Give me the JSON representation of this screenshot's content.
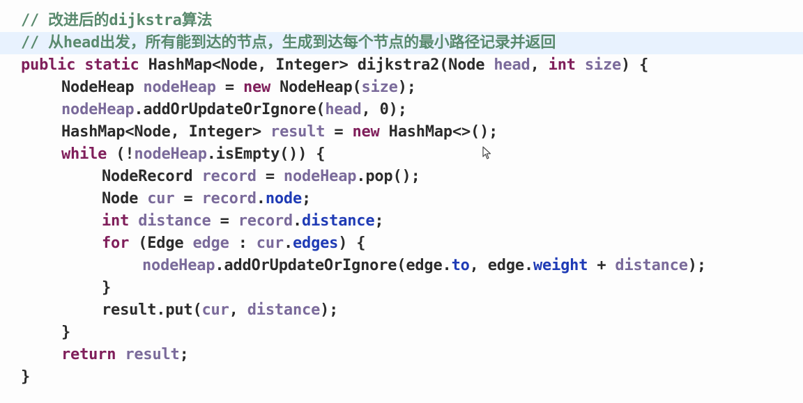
{
  "code": {
    "line1": {
      "comment": "// 改进后的dijkstra算法"
    },
    "line2": {
      "comment": "// 从head出发，所有能到达的节点，生成到达每个节点的最小路径记录并返回"
    },
    "line3": {
      "kw_public": "public",
      "kw_static": "static",
      "return_type": "HashMap<Node, Integer>",
      "method": "dijkstra2(Node",
      "param_head": "head",
      "comma": ",",
      "kw_int": "int",
      "param_size": "size",
      "close": ") {"
    },
    "line4": {
      "type": "NodeHeap",
      "var": "nodeHeap",
      "eq": "=",
      "kw_new": "new",
      "ctor": "NodeHeap(",
      "arg": "size",
      "end": ");"
    },
    "line5": {
      "var": "nodeHeap",
      "call": ".addOrUpdateOrIgnore(",
      "arg": "head",
      "end": ", 0);"
    },
    "line6": {
      "type": "HashMap<Node, Integer>",
      "var": "result",
      "eq": "=",
      "kw_new": "new",
      "ctor": "HashMap<>();"
    },
    "line7": {
      "kw_while": "while",
      "open": "(!",
      "var": "nodeHeap",
      "call": ".isEmpty()) {"
    },
    "line8": {
      "type": "NodeRecord",
      "var": "record",
      "eq": "=",
      "var2": "nodeHeap",
      "call": ".pop();"
    },
    "line9": {
      "type": "Node",
      "var": "cur",
      "eq": "=",
      "var2": "record",
      "dot": ".",
      "field": "node",
      "end": ";"
    },
    "line10": {
      "kw_int": "int",
      "var": "distance",
      "eq": "=",
      "var2": "record",
      "dot": ".",
      "field": "distance",
      "end": ";"
    },
    "line11": {
      "kw_for": "for",
      "open": "(Edge",
      "var": "edge",
      "colon": ":",
      "var2": "cur",
      "dot": ".",
      "field": "edges",
      "end": ") {"
    },
    "line12": {
      "var": "nodeHeap",
      "call": ".addOrUpdateOrIgnore(",
      "var2": "edge",
      "dot": ".",
      "field_to": "to",
      "comma": ",",
      "var3": "edge",
      "dot2": ".",
      "field_weight": "weight",
      "plus": "+",
      "var4": "distance",
      "end": ");"
    },
    "line13": {
      "brace": "}"
    },
    "line14": {
      "var": "result",
      "call": ".put(",
      "var2": "cur",
      "comma": ",",
      "var3": "distance",
      "end": ");"
    },
    "line15": {
      "brace": "}"
    },
    "line16": {
      "kw_return": "return",
      "var": "result",
      "end": ";"
    },
    "line17": {
      "brace": "}"
    }
  },
  "colors": {
    "comment": "#5a8a6e",
    "keyword": "#7f1e5a",
    "variable": "#7a6a9a",
    "field": "#1f3bb5",
    "text": "#2b2b2b",
    "highlight_line": "#e8f2fe"
  },
  "icons": {
    "cursor": "mouse-pointer-icon"
  }
}
